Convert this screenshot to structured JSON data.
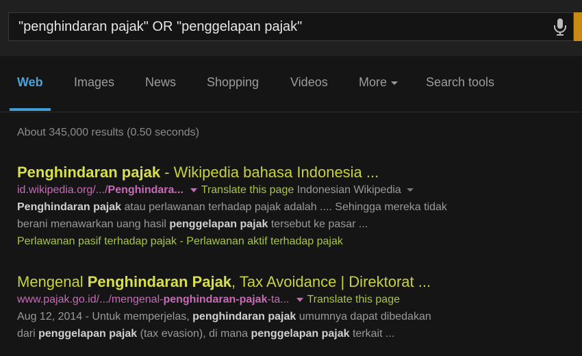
{
  "search": {
    "query": "\"penghindaran pajak\" OR \"penggelapan pajak\""
  },
  "tabs": [
    {
      "label": "Web",
      "active": true
    },
    {
      "label": "Images"
    },
    {
      "label": "News"
    },
    {
      "label": "Shopping"
    },
    {
      "label": "Videos"
    },
    {
      "label": "More"
    },
    {
      "label": "Search tools"
    }
  ],
  "stats": "About 345,000 results (0.50 seconds)",
  "results": [
    {
      "title_b1": "Penghindaran pajak",
      "title_rest": " - Wikipedia bahasa Indonesia ...",
      "url_a": "id.wikipedia.org/.../",
      "url_b": "Penghindara...",
      "translate": "Translate this page",
      "language": "Indonesian Wikipedia",
      "snippet1_b": "Penghindaran pajak",
      "snippet1_rest": " atau perlawanan terhadap pajak adalah .... Sehingga mereka tidak",
      "snippet2_a": "berani menawarkan uang hasil ",
      "snippet2_b": "penggelapan pajak",
      "snippet2_rest": " tersebut ke pasar ...",
      "sitelinks": "Perlawanan pasif terhadap pajak - Perlawanan aktif terhadap pajak"
    },
    {
      "title_a": "Mengenal ",
      "title_b": "Penghindaran Pajak",
      "title_rest": ", Tax Avoidance | Direktorat ...",
      "url_a": "www.pajak.go.id/.../mengenal-",
      "url_b": "penghindaran-pajak",
      "url_c": "-ta...",
      "translate": "Translate this page",
      "snippet1_a": "Aug 12, 2014 - Untuk memperjelas, ",
      "snippet1_b": "penghindaran pajak",
      "snippet1_rest": " umumnya dapat dibedakan",
      "snippet2_a": "dari ",
      "snippet2_b": "penggelapan pajak",
      "snippet2_mid": " (tax evasion), di mana ",
      "snippet2_b2": "penggelapan pajak",
      "snippet2_rest": " terkait ..."
    }
  ]
}
